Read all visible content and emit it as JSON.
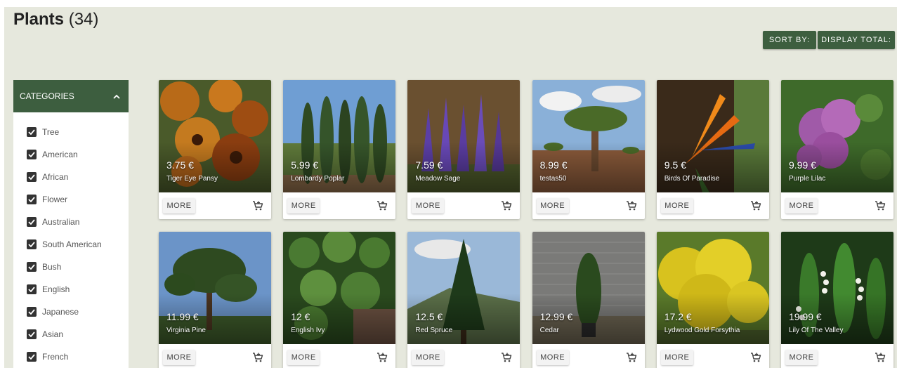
{
  "header": {
    "title": "Plants",
    "count": "(34)"
  },
  "toolbar": {
    "sort_label": "SORT BY:",
    "display_label": "DISPLAY TOTAL:"
  },
  "sidebar": {
    "header": "CATEGORIES",
    "toggle_icon": "chevron-up-icon",
    "categories": [
      {
        "label": "Tree",
        "checked": true
      },
      {
        "label": "American",
        "checked": true
      },
      {
        "label": "African",
        "checked": true
      },
      {
        "label": "Flower",
        "checked": true
      },
      {
        "label": "Australian",
        "checked": true
      },
      {
        "label": "South American",
        "checked": true
      },
      {
        "label": "Bush",
        "checked": true
      },
      {
        "label": "English",
        "checked": true
      },
      {
        "label": "Japanese",
        "checked": true
      },
      {
        "label": "Asian",
        "checked": true
      },
      {
        "label": "French",
        "checked": true
      }
    ]
  },
  "products": [
    {
      "price": "3.75 €",
      "name": "Tiger Eye Pansy"
    },
    {
      "price": "5.99 €",
      "name": "Lombardy Poplar"
    },
    {
      "price": "7.59 €",
      "name": "Meadow Sage"
    },
    {
      "price": "8.99 €",
      "name": "testas50"
    },
    {
      "price": "9.5 €",
      "name": "Birds Of Paradise"
    },
    {
      "price": "9.99 €",
      "name": "Purple Lilac"
    },
    {
      "price": "11.99 €",
      "name": "Virginia Pine"
    },
    {
      "price": "12 €",
      "name": "English Ivy"
    },
    {
      "price": "12.5 €",
      "name": "Red Spruce"
    },
    {
      "price": "12.99 €",
      "name": "Cedar"
    },
    {
      "price": "17.2 €",
      "name": "Lydwood Gold Forsythia"
    },
    {
      "price": "19.99 €",
      "name": "Lily Of The Valley"
    }
  ],
  "card": {
    "more_label": "MORE",
    "cart_icon": "add-to-cart-icon"
  },
  "colors": {
    "accent": "#3d5e3f",
    "background": "#e6e8dd"
  }
}
